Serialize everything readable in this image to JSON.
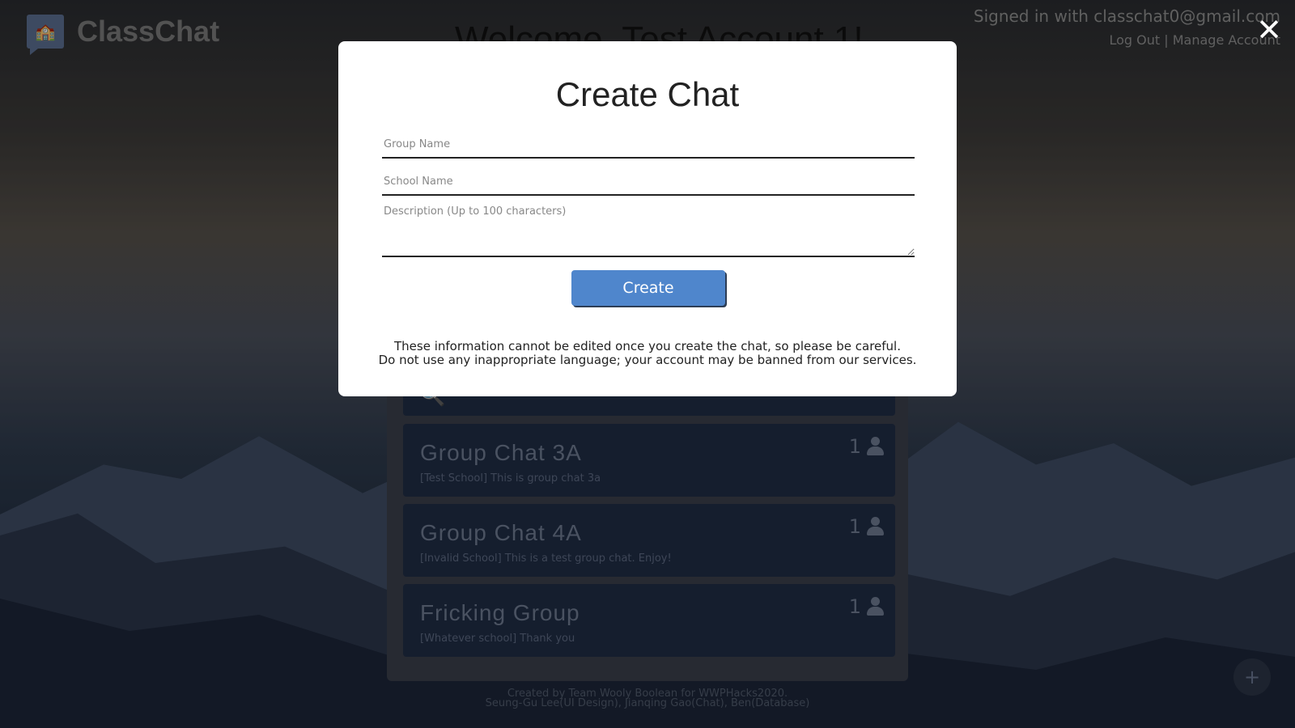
{
  "app": {
    "name": "ClassChat",
    "welcome": "Welcome, Test Account 1!"
  },
  "account": {
    "signed_in": "Signed in with classchat0@gmail.com",
    "log_out": "Log Out",
    "separator": "|",
    "manage": "Manage Account"
  },
  "modal": {
    "title": "Create Chat",
    "group_name_placeholder": "Group Name",
    "school_name_placeholder": "School Name",
    "description_placeholder": "Description (Up to 100 characters)",
    "create_label": "Create",
    "notice_line1": "These information cannot be edited once you create the chat, so please be careful.",
    "notice_line2": "Do not use any inappropriate language; your account may be banned from our services."
  },
  "chats": [
    {
      "title": "Group Chat 3A",
      "desc": "[Test School] This is group chat 3a",
      "count": "1"
    },
    {
      "title": "Group Chat 4A",
      "desc": "[Invalid School] This is a test group chat. Enjoy!",
      "count": "1"
    },
    {
      "title": "Fricking Group",
      "desc": "[Whatever school] Thank you",
      "count": "1"
    }
  ],
  "footer": {
    "line1": "Created by Team Wooly Boolean for WWPHacks2020.",
    "line2": "Seung-Gu Lee(UI Design), Jianqing Gao(Chat), Ben(Database)"
  },
  "fab_label": "+",
  "close_glyph": "✕"
}
